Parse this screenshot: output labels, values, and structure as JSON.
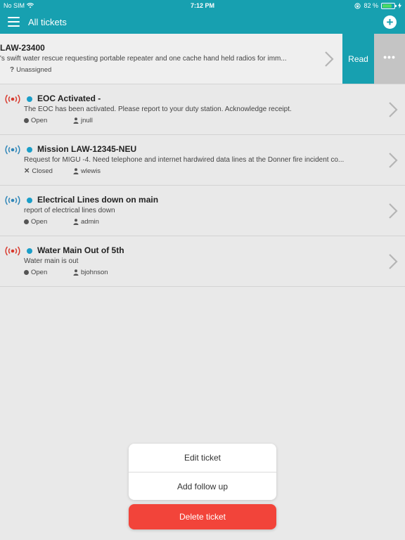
{
  "status_bar": {
    "carrier": "No SIM",
    "time": "7:12 PM",
    "battery_percent": "82 %",
    "battery_level": 0.82
  },
  "nav": {
    "title": "All tickets"
  },
  "colors": {
    "accent": "#17a0b0",
    "signal_red": "#d83a2e",
    "signal_blue": "#2f86b8",
    "unread_dot": "#1a9ec8",
    "delete": "#f2443a"
  },
  "tickets": [
    {
      "title": "LAW-23400",
      "description": "'s swift water rescue requesting portable repeater and one cache hand held radios for imm...",
      "status": "Unassigned",
      "status_icon": "question-icon",
      "user": "",
      "signal": "none",
      "swiped": true
    },
    {
      "title": "EOC Activated -",
      "description": "The EOC has been activated. Please report to your duty station. Acknowledge receipt.",
      "status": "Open",
      "status_icon": "dot-icon",
      "user": "jnull",
      "signal": "red"
    },
    {
      "title": "Mission LAW-12345-NEU",
      "description": "Request for MIGU -4. Need telephone and internet hardwired data lines at the Donner fire incident co...",
      "status": "Closed",
      "status_icon": "x-icon",
      "user": "wlewis",
      "signal": "blue"
    },
    {
      "title": "Electrical Lines down on main",
      "description": "report of electrical lines down",
      "status": "Open",
      "status_icon": "dot-icon",
      "user": "admin",
      "signal": "blue"
    },
    {
      "title": "Water Main Out of 5th",
      "description": "Water main is out",
      "status": "Open",
      "status_icon": "dot-icon",
      "user": "bjohnson",
      "signal": "red"
    }
  ],
  "swipe_actions": {
    "read": "Read",
    "more": "•••"
  },
  "action_sheet": {
    "edit": "Edit ticket",
    "follow_up": "Add follow up",
    "delete": "Delete ticket"
  }
}
